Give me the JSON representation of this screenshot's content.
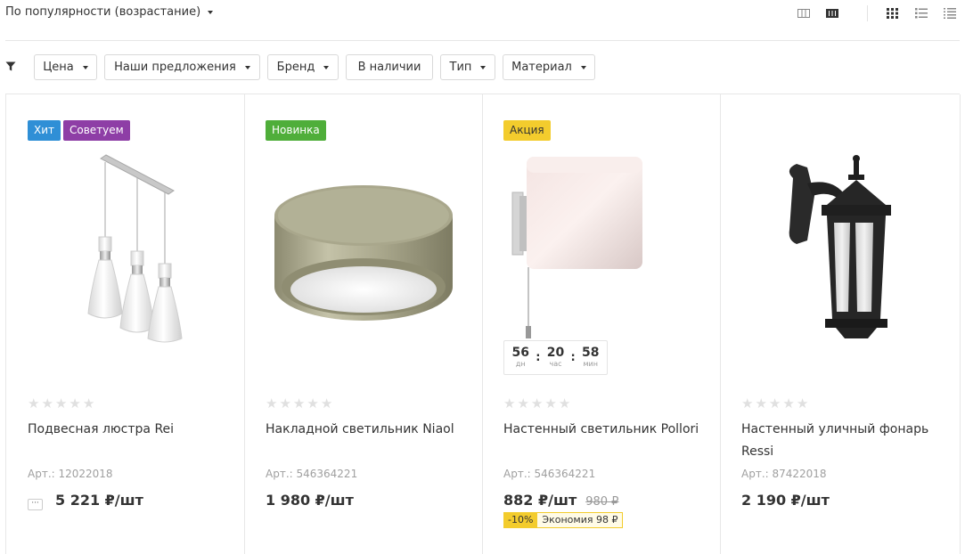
{
  "sort": {
    "label": "По популярности (возрастание)"
  },
  "view_toggles": [
    "view-cards-wide-icon",
    "view-cards-icon",
    "grid-view-icon",
    "list-view-icon",
    "compact-list-icon"
  ],
  "filters": {
    "icon": "filter-icon",
    "chips": [
      {
        "label": "Цена",
        "dropdown": true
      },
      {
        "label": "Наши предложения",
        "dropdown": true
      },
      {
        "label": "Бренд",
        "dropdown": true
      },
      {
        "label": "В наличии",
        "dropdown": false
      },
      {
        "label": "Тип",
        "dropdown": true
      },
      {
        "label": "Материал",
        "dropdown": true
      }
    ]
  },
  "products": [
    {
      "badges": [
        {
          "text": "Хит",
          "color": "#2f8fd6"
        },
        {
          "text": "Советуем",
          "color": "#8e3ea6"
        }
      ],
      "image": "pendant-chandelier",
      "rating": 0,
      "name": "Подвесная люстра Rei",
      "article": "Арт.: 12022018",
      "price": "5 221 ₽/шт",
      "more_icon": "more-dots-icon"
    },
    {
      "badges": [
        {
          "text": "Новинка",
          "color": "#4fae3a"
        }
      ],
      "image": "ceiling-light",
      "rating": 0,
      "name": "Накладной светильник Niaol",
      "article": "Арт.: 546364221",
      "price": "1 980 ₽/шт"
    },
    {
      "badges": [
        {
          "text": "Акция",
          "color": "#f3cc2d"
        }
      ],
      "image": "wall-light",
      "timer": {
        "days": "56",
        "days_label": "дн",
        "hours": "20",
        "hours_label": "час",
        "minutes": "58",
        "minutes_label": "мин"
      },
      "rating": 0,
      "name": "Настенный светильник Pollori",
      "article": "Арт.: 546364221",
      "price": "882 ₽/шт",
      "old_price": "980 ₽",
      "discount": "-10%",
      "economy": "Экономия 98 ₽"
    },
    {
      "badges": [],
      "image": "street-lantern",
      "rating": 0,
      "name": "Настенный уличный фонарь Ressi",
      "article": "Арт.: 87422018",
      "price": "2 190 ₽/шт"
    }
  ]
}
